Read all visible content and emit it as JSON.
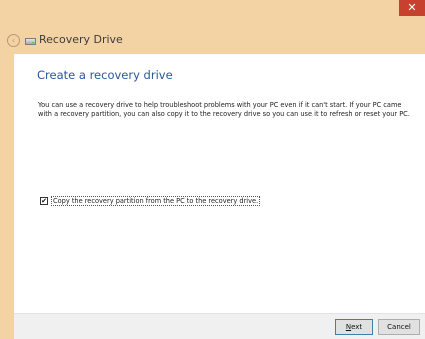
{
  "window": {
    "title": "Recovery Drive",
    "close_label": "✕",
    "back_label": "‹"
  },
  "page": {
    "heading": "Create a recovery drive",
    "description": "You can use a recovery drive to help troubleshoot problems with your PC even if it can't start. If your PC came with a recovery partition, you can also copy it to the recovery drive so you can use it to refresh or reset your PC.",
    "checkbox": {
      "checked": true,
      "mark": "✔",
      "label": "Copy the recovery partition from the PC to the recovery drive."
    }
  },
  "footer": {
    "next_label_first": "N",
    "next_label_rest": "ext",
    "cancel_label": "Cancel"
  },
  "colors": {
    "titlebar": "#f3d2a3",
    "close": "#c7412f",
    "heading": "#2a579a"
  },
  "icons": {
    "back": "back-arrow-icon",
    "drive": "drive-icon",
    "close": "close-icon"
  }
}
